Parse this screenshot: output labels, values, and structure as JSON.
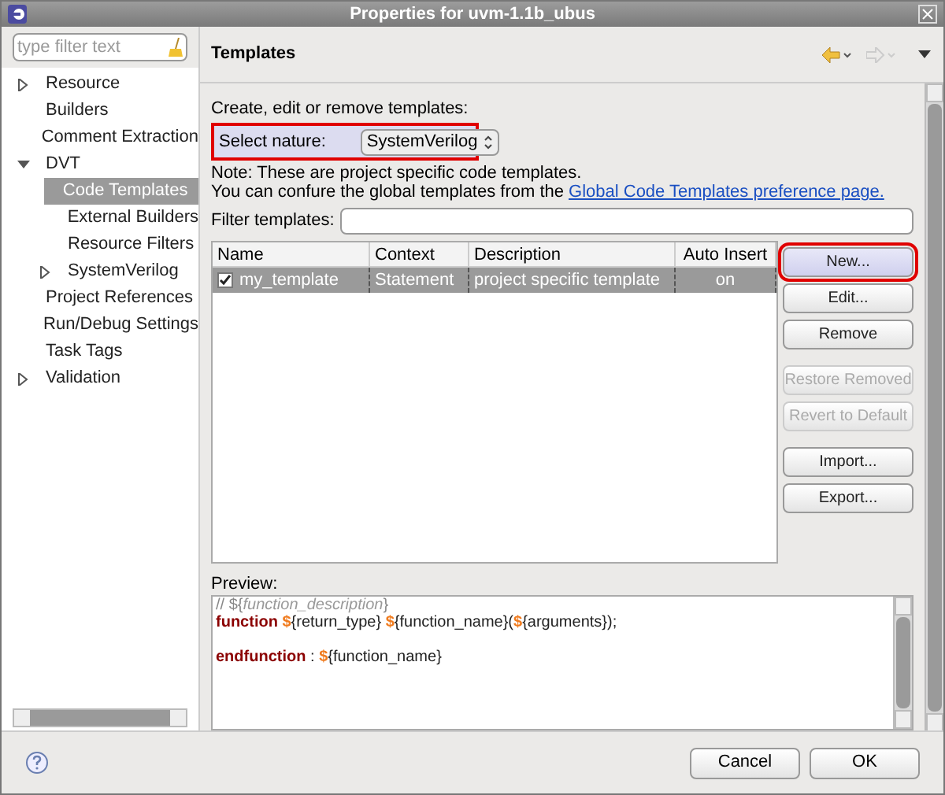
{
  "window": {
    "title": "Properties for uvm-1.1b_ubus"
  },
  "filter": {
    "placeholder": "type filter text"
  },
  "tree": [
    {
      "label": "Resource",
      "expanded": false,
      "selected": false
    },
    {
      "label": "Builders",
      "selected": false
    },
    {
      "label": "Comment Extraction",
      "selected": false
    },
    {
      "label": "DVT",
      "expanded": true,
      "selected": false,
      "children": [
        {
          "label": "Code Templates",
          "selected": true
        },
        {
          "label": "External Builders",
          "selected": false
        },
        {
          "label": "Resource Filters",
          "selected": false
        },
        {
          "label": "SystemVerilog",
          "expanded": false,
          "selected": false
        }
      ]
    },
    {
      "label": "Project References",
      "selected": false
    },
    {
      "label": "Run/Debug Settings",
      "selected": false
    },
    {
      "label": "Task Tags",
      "selected": false
    },
    {
      "label": "Validation",
      "expanded": false,
      "selected": false
    }
  ],
  "page": {
    "title": "Templates",
    "intro": "Create, edit or remove templates:",
    "nature_label": "Select nature:",
    "nature_value": "SystemVerilog",
    "nature_highlighted": true,
    "note": "Note: These are project specific code templates.",
    "note2": "You can confure the global templates from the",
    "link": "Global Code Templates preference page.",
    "filter_label": "Filter templates:"
  },
  "table": {
    "columns": [
      "Name",
      "Context",
      "Description",
      "Auto Insert"
    ],
    "rows": [
      {
        "checked": true,
        "selected": true,
        "cells": [
          "my_template",
          "Statement",
          "project specific template",
          "on"
        ]
      }
    ]
  },
  "button_groups": [
    [
      {
        "label": "New...",
        "disabled": false,
        "highlighted": true
      },
      {
        "label": "Edit...",
        "disabled": false,
        "highlighted": false
      },
      {
        "label": "Remove",
        "disabled": false,
        "highlighted": false
      }
    ],
    [
      {
        "label": "Restore Removed",
        "disabled": true,
        "highlighted": false
      },
      {
        "label": "Revert to Default",
        "disabled": true,
        "highlighted": false
      }
    ],
    [
      {
        "label": "Import...",
        "disabled": false,
        "highlighted": false
      },
      {
        "label": "Export...",
        "disabled": false,
        "highlighted": false
      }
    ]
  ],
  "preview": {
    "label": "Preview:",
    "lines": [
      {
        "blank_before": false,
        "segments": [
          {
            "kind": "comment",
            "text": "// "
          },
          {
            "kind": "comment",
            "text": "$"
          },
          {
            "kind": "comment",
            "text": "{"
          },
          {
            "kind": "comment_var",
            "text": "function_description"
          },
          {
            "kind": "comment",
            "text": "}"
          }
        ]
      },
      {
        "blank_before": false,
        "segments": [
          {
            "kind": "keyword",
            "text": "function"
          },
          {
            "kind": "sign",
            "text": " $"
          },
          {
            "kind": "plain",
            "text": "{return_type} "
          },
          {
            "kind": "sign",
            "text": "$"
          },
          {
            "kind": "plain",
            "text": "{function_name}("
          },
          {
            "kind": "sign",
            "text": "$"
          },
          {
            "kind": "plain",
            "text": "{arguments});"
          }
        ]
      },
      {
        "blank_before": true,
        "segments": [
          {
            "kind": "keyword",
            "text": "endfunction"
          },
          {
            "kind": "plain",
            "text": " : "
          },
          {
            "kind": "sign",
            "text": "$"
          },
          {
            "kind": "plain",
            "text": "{function_name}"
          }
        ]
      }
    ]
  },
  "footer": {
    "buttons": [
      "Cancel",
      "OK"
    ]
  }
}
